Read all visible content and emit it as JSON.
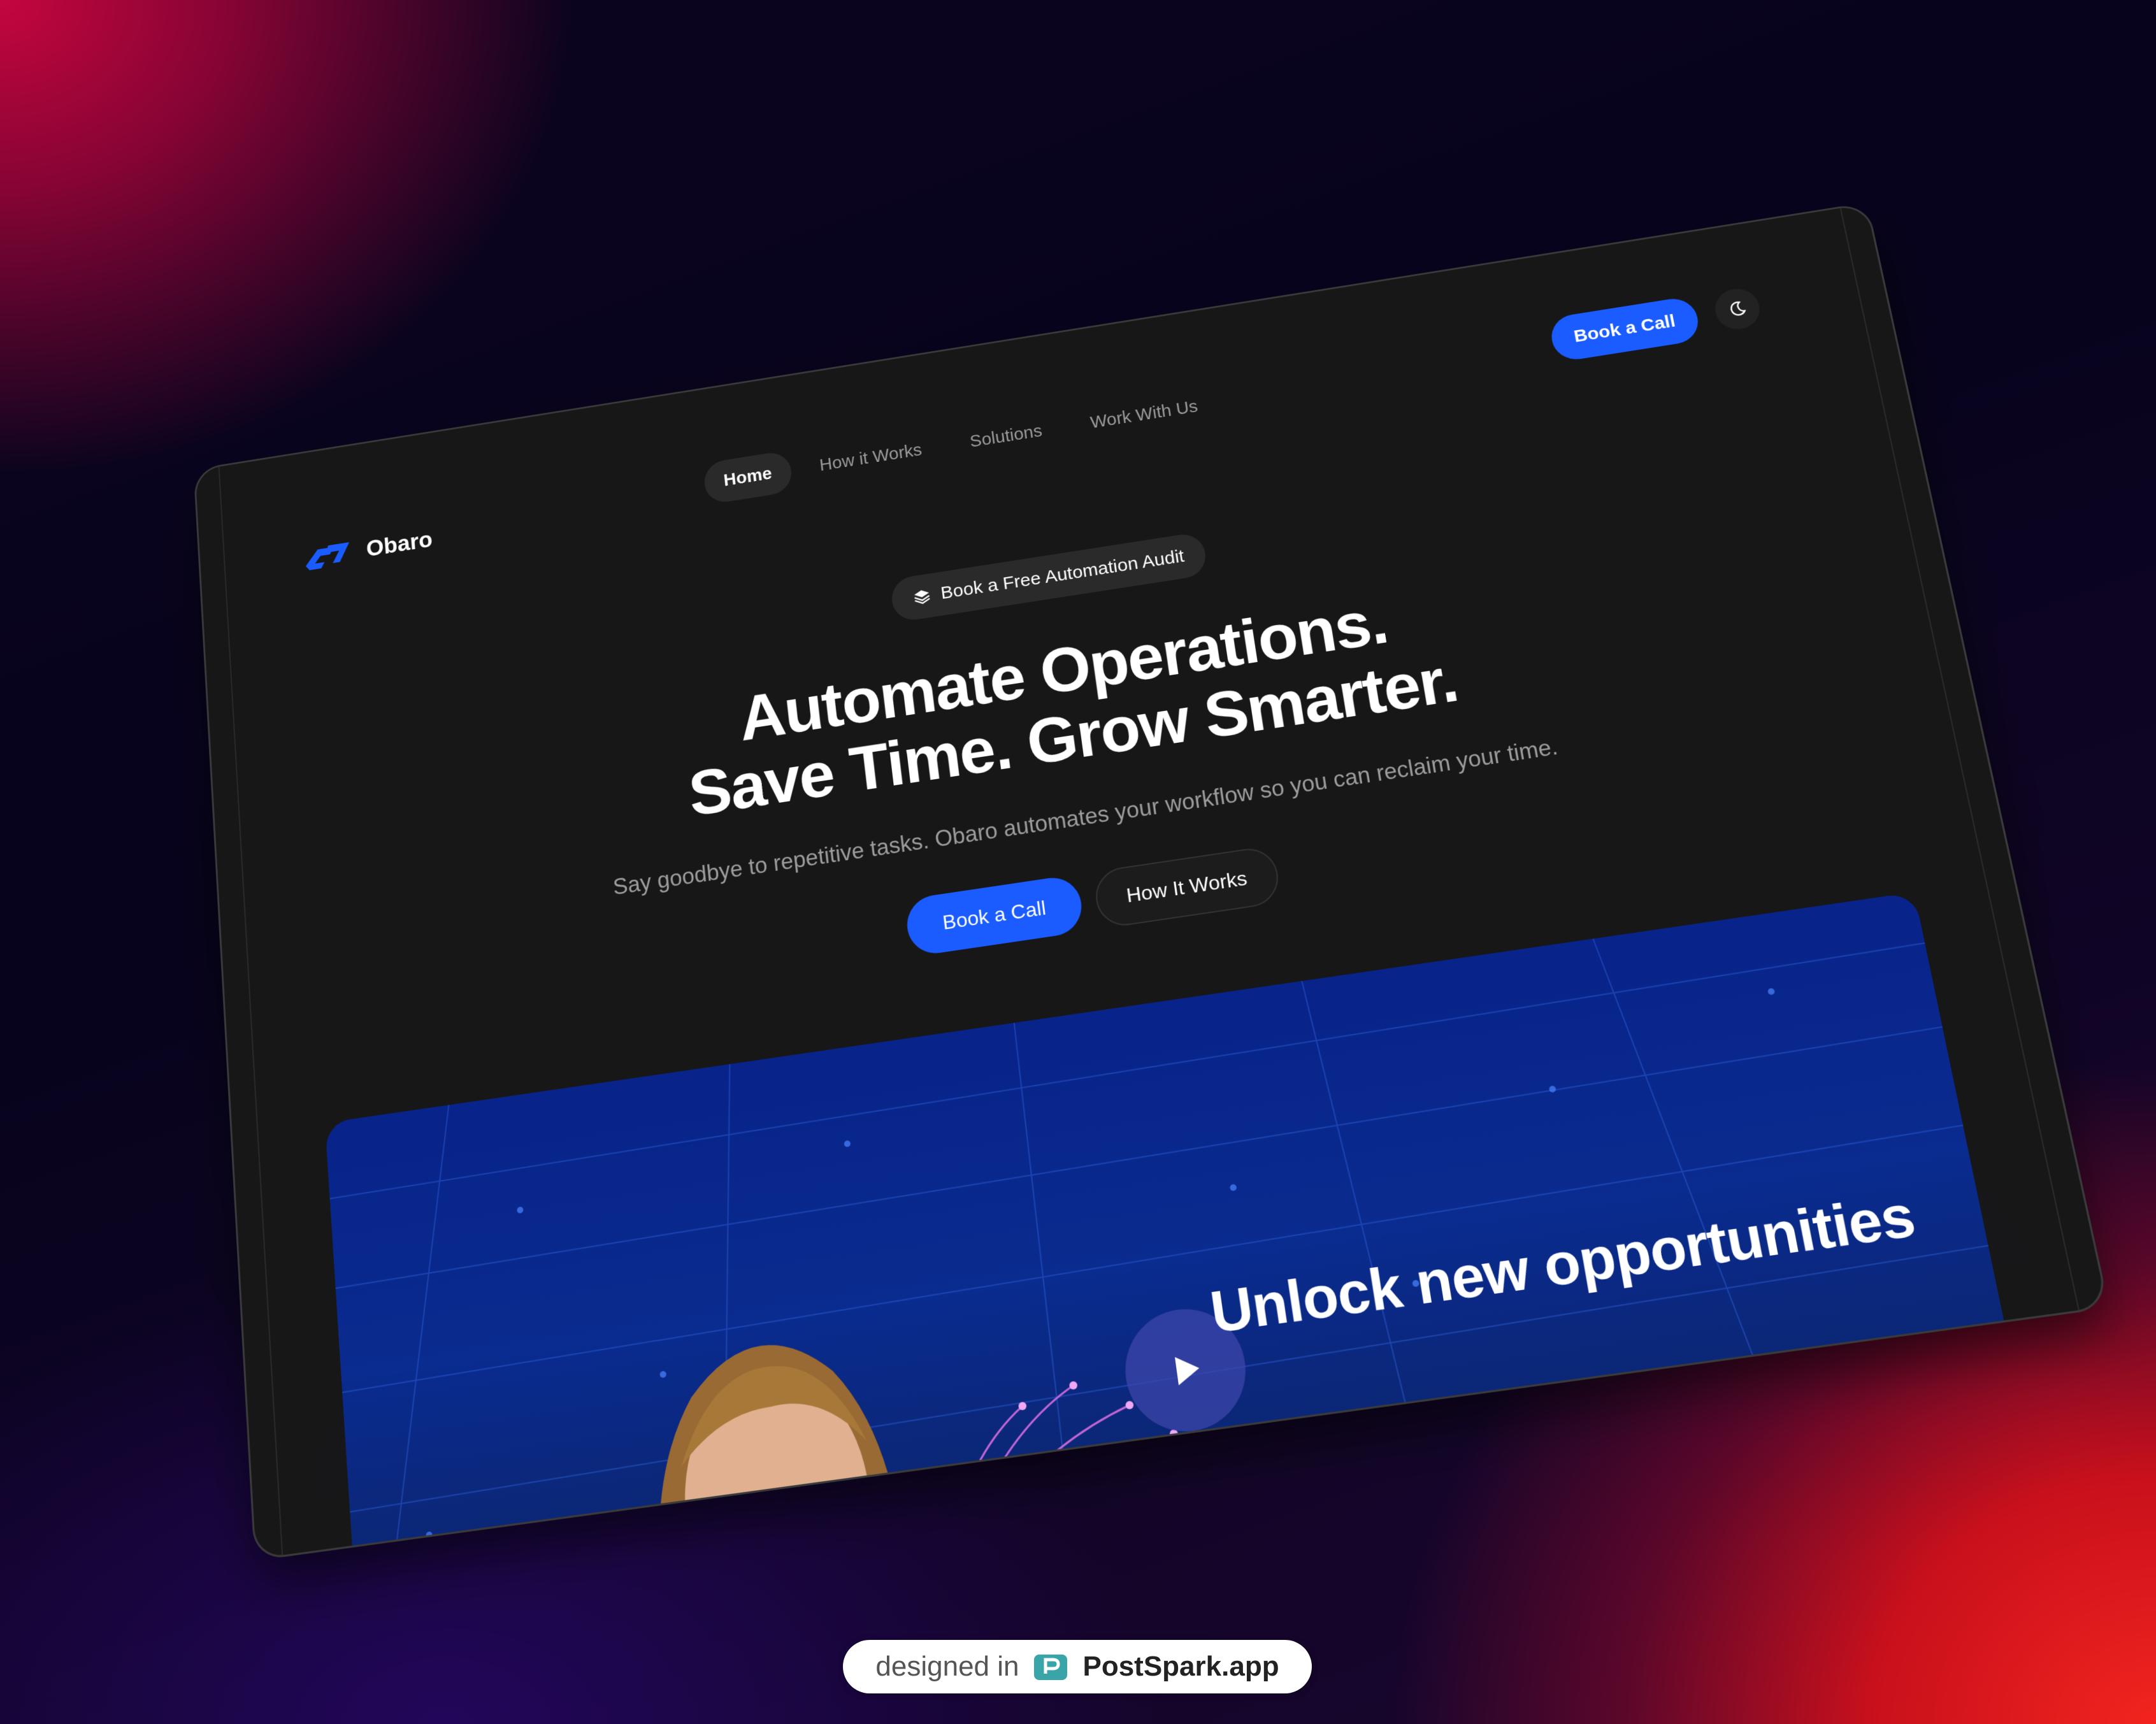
{
  "brand": {
    "name": "Obaro",
    "logo_icon": "obaro-logo-icon",
    "accent": "#1a5cff"
  },
  "nav": {
    "items": [
      {
        "label": "Home",
        "active": true
      },
      {
        "label": "How it Works"
      },
      {
        "label": "Solutions"
      },
      {
        "label": "Work With Us"
      }
    ]
  },
  "header": {
    "cta_label": "Book a Call",
    "theme_icon": "moon-icon"
  },
  "badge": {
    "icon": "layers-icon",
    "label": "Book a Free Automation Audit"
  },
  "hero": {
    "title_line1": "Automate Operations.",
    "title_line2": "Save Time. Grow Smarter.",
    "subtitle": "Say goodbye to repetitive tasks. Obaro automates your workflow so you can reclaim your time.",
    "primary_cta": "Book a Call",
    "secondary_cta": "How It Works"
  },
  "video": {
    "overlay_text": "Unlock new opportunities",
    "play_icon": "play-icon"
  },
  "footer": {
    "prefix": "designed in",
    "brand": "PostSpark.app",
    "icon": "postspark-icon"
  }
}
